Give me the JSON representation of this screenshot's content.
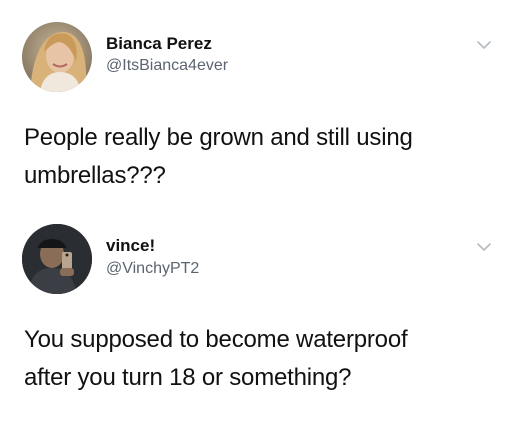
{
  "tweets": [
    {
      "name": "Bianca Perez",
      "handle": "@ItsBianca4ever",
      "text_lines": [
        "People really be grown and still using",
        "umbrellas???"
      ],
      "avatar_icon": "profile-photo-woman",
      "menu_icon": "chevron-down-icon"
    },
    {
      "name": "vince!",
      "handle": "@VinchyPT2",
      "text_lines": [
        "You supposed to become waterproof",
        "after you turn 18 or something?"
      ],
      "avatar_icon": "profile-photo-man-mirror-selfie",
      "menu_icon": "chevron-down-icon"
    }
  ],
  "colors": {
    "text": "#111111",
    "handle": "#5b6470",
    "chevron": "#b7bcc2",
    "background": "#ffffff"
  }
}
